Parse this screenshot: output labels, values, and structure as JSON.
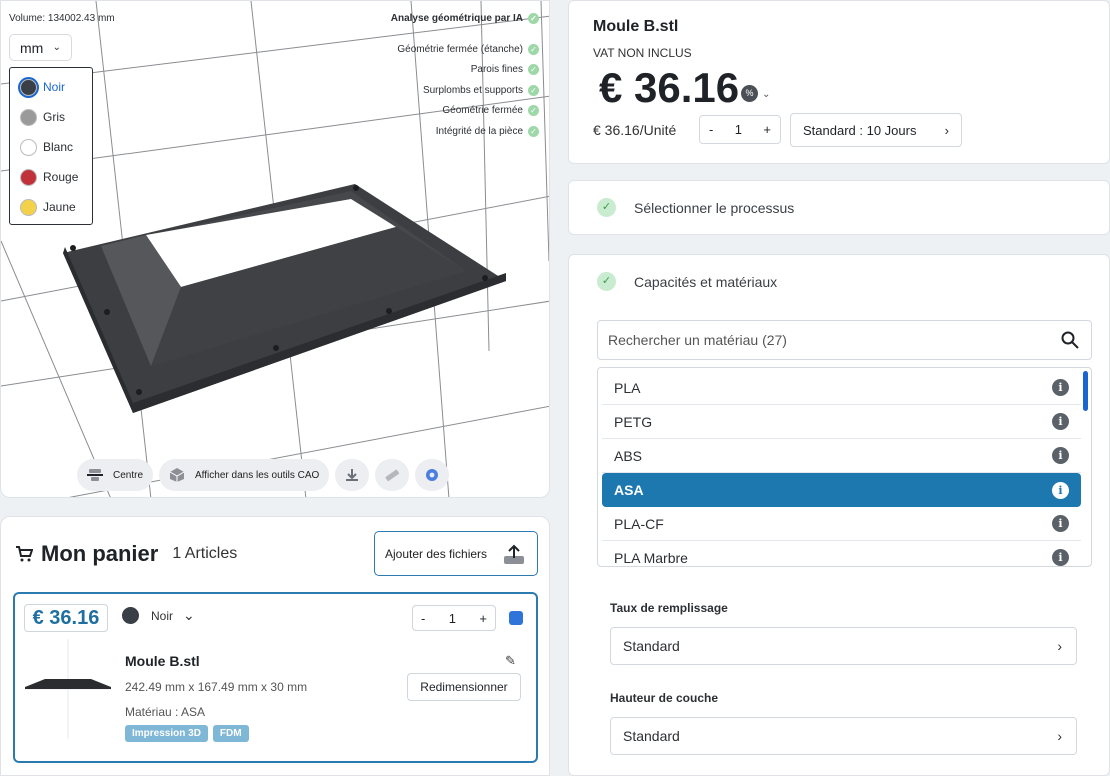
{
  "viewer": {
    "volume": "Volume: 134002.43 mm",
    "unit": "mm",
    "colors": [
      {
        "label": "Noir",
        "hex": "#3a3f47",
        "selected": true
      },
      {
        "label": "Gris",
        "hex": "#9a9a9a",
        "selected": false
      },
      {
        "label": "Blanc",
        "hex": "#ffffff",
        "selected": false
      },
      {
        "label": "Rouge",
        "hex": "#c0313a",
        "selected": false
      },
      {
        "label": "Jaune",
        "hex": "#f3d24a",
        "selected": false
      }
    ],
    "analysis_title": "Analyse géométrique par IA",
    "checks": [
      "Géométrie fermée (étanche)",
      "Parois fines",
      "Surplombs et supports",
      "Géométrie fermée",
      "Intégrité de la pièce"
    ],
    "toolbar": {
      "center": "Centre",
      "cad": "Afficher dans les outils CAO"
    }
  },
  "cart": {
    "title": "Mon panier",
    "count": "1 Articles",
    "add_files": "Ajouter des fichiers",
    "item": {
      "price": "€ 36.16",
      "color": "Noir",
      "qty": "1",
      "name": "Moule B.stl",
      "dims": "242.49 mm x 167.49 mm x 30 mm",
      "material": "Matériau : ASA",
      "tags": [
        "Impression 3D",
        "FDM"
      ],
      "resize": "Redimensionner"
    }
  },
  "summary": {
    "name": "Moule B.stl",
    "vat": "VAT NON INCLUS",
    "price": "€ 36.16",
    "unit_price": "€ 36.16/Unité",
    "qty": "1",
    "lead": "Standard : 10 Jours"
  },
  "steps": {
    "process": "Sélectionner le processus",
    "materials": "Capacités et matériaux"
  },
  "materials": {
    "search_placeholder": "Rechercher un matériau (27)",
    "items": [
      "PLA",
      "PETG",
      "ABS",
      "ASA",
      "PLA-CF",
      "PLA Marbre"
    ],
    "selected": "ASA"
  },
  "infill": {
    "label": "Taux de remplissage",
    "value": "Standard"
  },
  "layer": {
    "label": "Hauteur de couche",
    "value": "Standard"
  },
  "accent": "#1e78b0"
}
